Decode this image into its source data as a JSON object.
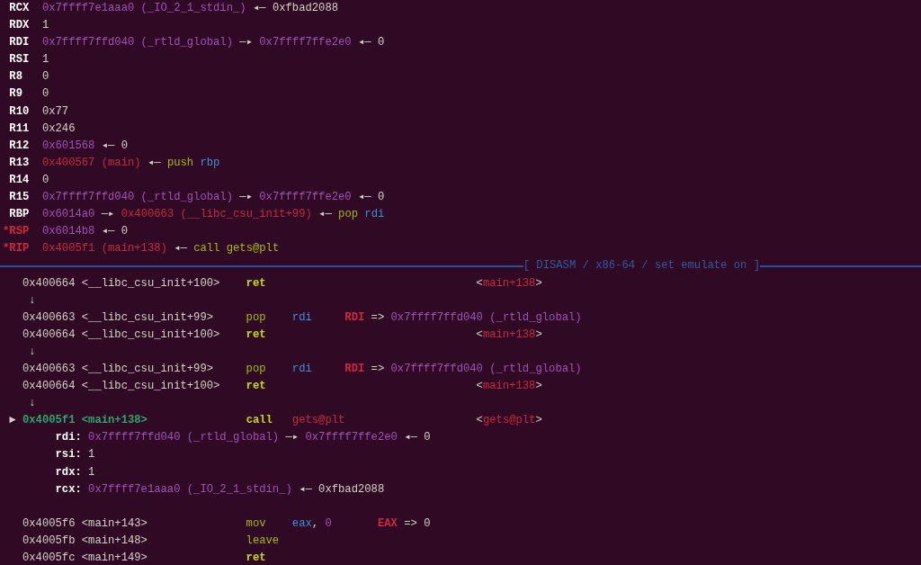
{
  "lines": [
    {
      "kind": "register",
      "segments": [
        {
          "kind": "reg",
          "text": " RCX"
        },
        {
          "kind": "addr",
          "text": "  0x7ffff7e1aaa0 (_IO_2_1_stdin_)"
        },
        {
          "kind": "plain",
          "text": " ◂— 0xfbad2088"
        }
      ]
    },
    {
      "kind": "register",
      "segments": [
        {
          "kind": "reg",
          "text": " RDX"
        },
        {
          "kind": "plain",
          "text": "  1"
        }
      ]
    },
    {
      "kind": "register",
      "segments": [
        {
          "kind": "reg",
          "text": " RDI"
        },
        {
          "kind": "addr",
          "text": "  0x7ffff7ffd040 (_rtld_global)"
        },
        {
          "kind": "plain",
          "text": " —▸ "
        },
        {
          "kind": "addr",
          "text": "0x7ffff7ffe2e0"
        },
        {
          "kind": "plain",
          "text": " ◂— 0"
        }
      ]
    },
    {
      "kind": "register",
      "segments": [
        {
          "kind": "reg",
          "text": " RSI"
        },
        {
          "kind": "plain",
          "text": "  1"
        }
      ]
    },
    {
      "kind": "register",
      "segments": [
        {
          "kind": "reg",
          "text": " R8"
        },
        {
          "kind": "plain",
          "text": "   0"
        }
      ]
    },
    {
      "kind": "register",
      "segments": [
        {
          "kind": "reg",
          "text": " R9"
        },
        {
          "kind": "plain",
          "text": "   0"
        }
      ]
    },
    {
      "kind": "register",
      "segments": [
        {
          "kind": "reg",
          "text": " R10"
        },
        {
          "kind": "plain",
          "text": "  0x77"
        }
      ]
    },
    {
      "kind": "register",
      "segments": [
        {
          "kind": "reg",
          "text": " R11"
        },
        {
          "kind": "plain",
          "text": "  0x246"
        }
      ]
    },
    {
      "kind": "register",
      "segments": [
        {
          "kind": "reg",
          "text": " R12"
        },
        {
          "kind": "addr",
          "text": "  0x601568"
        },
        {
          "kind": "plain",
          "text": " ◂— 0"
        }
      ]
    },
    {
      "kind": "register",
      "segments": [
        {
          "kind": "reg",
          "text": " R13"
        },
        {
          "kind": "code",
          "text": "  0x400567 (main)"
        },
        {
          "kind": "plain",
          "text": " ◂— "
        },
        {
          "kind": "op",
          "text": "push"
        },
        {
          "kind": "operand",
          "text": " rbp"
        }
      ]
    },
    {
      "kind": "register",
      "segments": [
        {
          "kind": "reg",
          "text": " R14"
        },
        {
          "kind": "plain",
          "text": "  0"
        }
      ]
    },
    {
      "kind": "register",
      "segments": [
        {
          "kind": "reg",
          "text": " R15"
        },
        {
          "kind": "addr",
          "text": "  0x7ffff7ffd040 (_rtld_global)"
        },
        {
          "kind": "plain",
          "text": " —▸ "
        },
        {
          "kind": "addr",
          "text": "0x7ffff7ffe2e0"
        },
        {
          "kind": "plain",
          "text": " ◂— 0"
        }
      ]
    },
    {
      "kind": "register",
      "segments": [
        {
          "kind": "reg",
          "text": " RBP"
        },
        {
          "kind": "addr",
          "text": "  0x6014a0"
        },
        {
          "kind": "plain",
          "text": " —▸ "
        },
        {
          "kind": "code",
          "text": "0x400663 (__libc_csu_init+99)"
        },
        {
          "kind": "plain",
          "text": " ◂— "
        },
        {
          "kind": "op",
          "text": "pop"
        },
        {
          "kind": "operand",
          "text": " rdi"
        }
      ]
    },
    {
      "kind": "register",
      "segments": [
        {
          "kind": "reg-changed",
          "text": "*RSP"
        },
        {
          "kind": "addr",
          "text": "  0x6014b8"
        },
        {
          "kind": "plain",
          "text": " ◂— 0"
        }
      ]
    },
    {
      "kind": "register",
      "segments": [
        {
          "kind": "reg-changed",
          "text": "*RIP"
        },
        {
          "kind": "code",
          "text": "  0x4005f1 (main+138)"
        },
        {
          "kind": "plain",
          "text": " ◂— "
        },
        {
          "kind": "op",
          "text": "call gets@plt"
        }
      ]
    },
    {
      "kind": "header",
      "title": "[ DISASM / x86-64 / set emulate on ]"
    },
    {
      "kind": "instruction",
      "segments": [
        {
          "kind": "plain",
          "text": "   0x400664 <__libc_csu_init+100>    "
        },
        {
          "kind": "op-bold",
          "text": "ret"
        },
        {
          "kind": "plain",
          "text": "                                <"
        },
        {
          "kind": "code",
          "text": "main+138"
        },
        {
          "kind": "plain",
          "text": ">"
        }
      ]
    },
    {
      "kind": "arrow",
      "segments": [
        {
          "kind": "plain",
          "text": "    ↓"
        }
      ]
    },
    {
      "kind": "instruction",
      "segments": [
        {
          "kind": "plain",
          "text": "   0x400663 <__libc_csu_init+99>     "
        },
        {
          "kind": "op",
          "text": "pop"
        },
        {
          "kind": "operand",
          "text": "    rdi"
        },
        {
          "kind": "reg-changed",
          "text": "     RDI"
        },
        {
          "kind": "plain",
          "text": " => "
        },
        {
          "kind": "addr",
          "text": "0x7ffff7ffd040 (_rtld_global)"
        }
      ]
    },
    {
      "kind": "instruction",
      "segments": [
        {
          "kind": "plain",
          "text": "   0x400664 <__libc_csu_init+100>    "
        },
        {
          "kind": "op-bold",
          "text": "ret"
        },
        {
          "kind": "plain",
          "text": "                                <"
        },
        {
          "kind": "code",
          "text": "main+138"
        },
        {
          "kind": "plain",
          "text": ">"
        }
      ]
    },
    {
      "kind": "arrow",
      "segments": [
        {
          "kind": "plain",
          "text": "    ↓"
        }
      ]
    },
    {
      "kind": "instruction",
      "segments": [
        {
          "kind": "plain",
          "text": "   0x400663 <__libc_csu_init+99>     "
        },
        {
          "kind": "op",
          "text": "pop"
        },
        {
          "kind": "operand",
          "text": "    rdi"
        },
        {
          "kind": "reg-changed",
          "text": "     RDI"
        },
        {
          "kind": "plain",
          "text": " => "
        },
        {
          "kind": "addr",
          "text": "0x7ffff7ffd040 (_rtld_global)"
        }
      ]
    },
    {
      "kind": "instruction",
      "segments": [
        {
          "kind": "plain",
          "text": "   0x400664 <__libc_csu_init+100>    "
        },
        {
          "kind": "op-bold",
          "text": "ret"
        },
        {
          "kind": "plain",
          "text": "                                <"
        },
        {
          "kind": "code",
          "text": "main+138"
        },
        {
          "kind": "plain",
          "text": ">"
        }
      ]
    },
    {
      "kind": "arrow",
      "segments": [
        {
          "kind": "plain",
          "text": "    ↓"
        }
      ]
    },
    {
      "kind": "instruction",
      "segments": [
        {
          "kind": "plain",
          "text": " ► "
        },
        {
          "kind": "current",
          "text": "0x4005f1 <main+138>"
        },
        {
          "kind": "op-bold",
          "text": "               call"
        },
        {
          "kind": "code",
          "text": "   gets@plt"
        },
        {
          "kind": "plain",
          "text": "                    <"
        },
        {
          "kind": "code",
          "text": "gets@plt"
        },
        {
          "kind": "plain",
          "text": ">"
        }
      ]
    },
    {
      "kind": "argument",
      "segments": [
        {
          "kind": "reg",
          "text": "        rdi:"
        },
        {
          "kind": "addr",
          "text": " 0x7ffff7ffd040 (_rtld_global)"
        },
        {
          "kind": "plain",
          "text": " —▸ "
        },
        {
          "kind": "addr",
          "text": "0x7ffff7ffe2e0"
        },
        {
          "kind": "plain",
          "text": " ◂— 0"
        }
      ]
    },
    {
      "kind": "argument",
      "segments": [
        {
          "kind": "reg",
          "text": "        rsi:"
        },
        {
          "kind": "plain",
          "text": " 1"
        }
      ]
    },
    {
      "kind": "argument",
      "segments": [
        {
          "kind": "reg",
          "text": "        rdx:"
        },
        {
          "kind": "plain",
          "text": " 1"
        }
      ]
    },
    {
      "kind": "argument",
      "segments": [
        {
          "kind": "reg",
          "text": "        rcx:"
        },
        {
          "kind": "addr",
          "text": " 0x7ffff7e1aaa0 (_IO_2_1_stdin_)"
        },
        {
          "kind": "plain",
          "text": " ◂— 0xfbad2088"
        }
      ]
    },
    {
      "kind": "blank"
    },
    {
      "kind": "instruction",
      "segments": [
        {
          "kind": "plain",
          "text": "   0x4005f6 <main+143>               "
        },
        {
          "kind": "op",
          "text": "mov"
        },
        {
          "kind": "operand",
          "text": "    eax"
        },
        {
          "kind": "plain",
          "text": ", "
        },
        {
          "kind": "addr",
          "text": "0"
        },
        {
          "kind": "reg-changed",
          "text": "       EAX"
        },
        {
          "kind": "plain",
          "text": " => 0"
        }
      ]
    },
    {
      "kind": "instruction",
      "segments": [
        {
          "kind": "plain",
          "text": "   0x4005fb <main+148>               "
        },
        {
          "kind": "op",
          "text": "leave"
        }
      ]
    },
    {
      "kind": "instruction",
      "segments": [
        {
          "kind": "plain",
          "text": "   0x4005fc <main+149>               "
        },
        {
          "kind": "op-bold",
          "text": "ret"
        }
      ]
    }
  ]
}
